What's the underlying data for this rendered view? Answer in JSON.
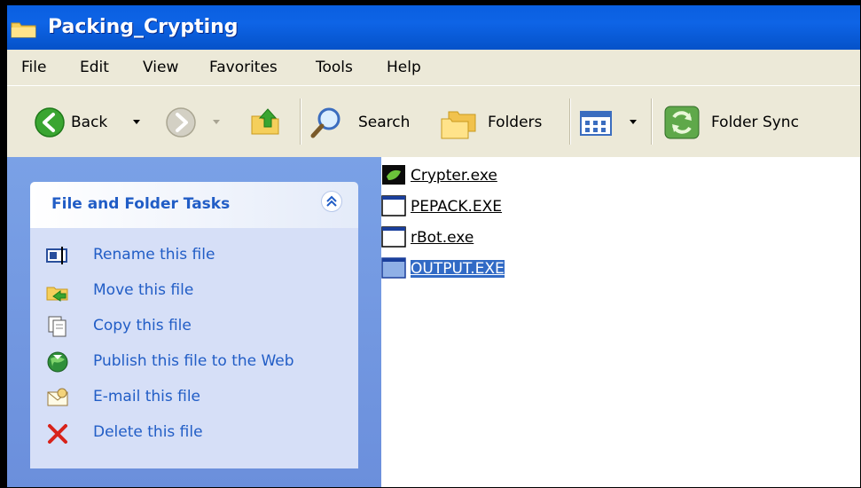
{
  "window": {
    "title": "Packing_Crypting"
  },
  "menubar": {
    "items": [
      "File",
      "Edit",
      "View",
      "Favorites",
      "Tools",
      "Help"
    ]
  },
  "toolbar": {
    "back_label": "Back",
    "search_label": "Search",
    "folders_label": "Folders",
    "folder_sync_label": "Folder Sync"
  },
  "tasks": {
    "title": "File and Folder Tasks",
    "items": [
      {
        "label": "Rename this file",
        "icon": "rename-icon"
      },
      {
        "label": "Move this file",
        "icon": "move-icon"
      },
      {
        "label": "Copy this file",
        "icon": "copy-icon"
      },
      {
        "label": "Publish this file to the Web",
        "icon": "publish-web-icon"
      },
      {
        "label": "E-mail this file",
        "icon": "email-icon"
      },
      {
        "label": "Delete this file",
        "icon": "delete-icon"
      }
    ]
  },
  "files": [
    {
      "name": "Crypter.exe",
      "icon": "crypter-exe-icon",
      "selected": false
    },
    {
      "name": "PEPACK.EXE",
      "icon": "window-exe-icon",
      "selected": false
    },
    {
      "name": "rBot.exe",
      "icon": "window-exe-icon",
      "selected": false
    },
    {
      "name": "OUTPUT.EXE",
      "icon": "window-exe-icon",
      "selected": true
    }
  ],
  "colors": {
    "titlebar": "#0a5fe0",
    "sidebar": "#6b8fdc",
    "task_link": "#215dc6",
    "selection": "#316ac5"
  }
}
